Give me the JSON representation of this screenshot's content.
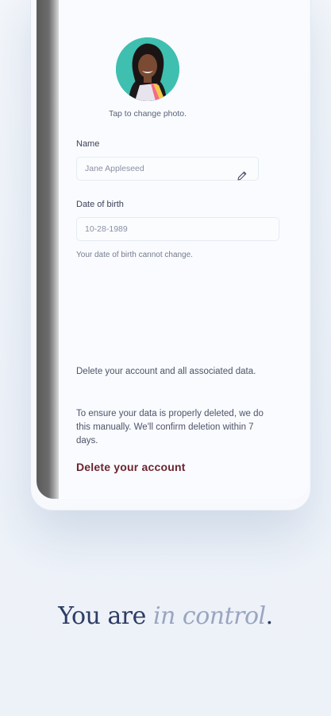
{
  "profile": {
    "photo_caption": "Tap to change photo.",
    "name_label": "Name",
    "name_value": "Jane Appleseed",
    "dob_label": "Date of birth",
    "dob_value": "10-28-1989",
    "dob_helper": "Your date of birth cannot change."
  },
  "account": {
    "delete_description": "Delete your account and all associated data.",
    "delete_note": "To ensure your data is properly deleted, we do this manually. We'll confirm deletion within 7 days.",
    "delete_link": "Delete your account"
  },
  "tagline": {
    "prefix": "You are ",
    "emphasis": "in control",
    "suffix": "."
  },
  "colors": {
    "avatar_bg": "#3fbfb0",
    "danger_link": "#6b2430",
    "tagline": "#2f3c64",
    "tagline_emphasis": "#9aa5c0"
  },
  "icons": {
    "edit": "pencil-icon"
  }
}
